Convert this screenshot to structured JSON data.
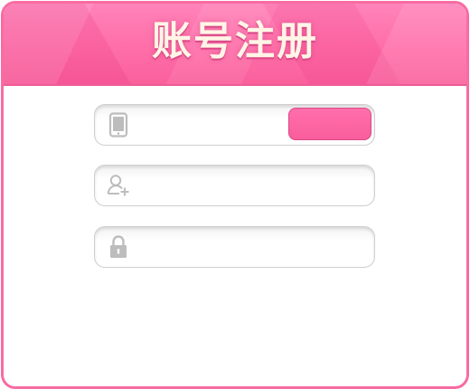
{
  "dialog": {
    "title": "账号注册"
  },
  "form": {
    "phone": {
      "icon": "tablet-icon",
      "value": "",
      "placeholder": "",
      "send_button_label": ""
    },
    "username": {
      "icon": "user-add-icon",
      "value": "",
      "placeholder": ""
    },
    "password": {
      "icon": "lock-icon",
      "value": "",
      "placeholder": ""
    }
  },
  "colors": {
    "accent": "#f76ca2",
    "header": "#ff6ea8",
    "title_text": "#fff5e6",
    "icon_gray": "#bdbdbd"
  }
}
